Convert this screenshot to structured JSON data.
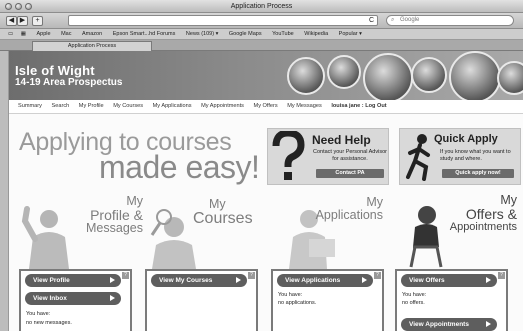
{
  "browser": {
    "window_title": "Application Process",
    "url": "",
    "search_placeholder": "Google",
    "bookmarks": [
      "Apple",
      "Mac",
      "Amazon",
      "Epson Smart...hd Forums",
      "News (109) ▾",
      "Google Maps",
      "YouTube",
      "Wikipedia",
      "Popular ▾"
    ],
    "tab_label": "Application Process"
  },
  "site": {
    "title": "Isle of Wight",
    "subtitle": "14-19 Area Prospectus",
    "nav": [
      "Summary",
      "Search",
      "My Profile",
      "My Courses",
      "My Applications",
      "My Appointments",
      "My Offers",
      "My Messages"
    ],
    "user_link": "louisa jane : Log Out"
  },
  "hero": {
    "line1": "Applying to courses",
    "line2": "made easy!"
  },
  "need_help": {
    "title": "Need Help",
    "text": "Contact your Personal Advisor for assistance.",
    "button": "Contact PA"
  },
  "quick_apply": {
    "title": "Quick Apply",
    "text": "If you know what you want to study and where.",
    "button": "Quick apply now!"
  },
  "sections": {
    "profile": {
      "title_line1": "My",
      "title_line2": "Profile &",
      "title_line3": "Messages",
      "button1": "View Profile",
      "button2": "View Inbox",
      "text1": "You have:",
      "text2": "no new messages."
    },
    "courses": {
      "title_line1": "My",
      "title_line2": "Courses",
      "button1": "View My Courses"
    },
    "applications": {
      "title_line1": "My",
      "title_line2": "Applications",
      "button1": "View Applications",
      "text1": "You have:",
      "text2": "no applications."
    },
    "offers": {
      "title_line1": "My",
      "title_line2": "Offers &",
      "title_line3": "Appointments",
      "button1": "View Offers",
      "button2": "View Appointments",
      "text1": "You have:",
      "text2": "no offers."
    }
  },
  "help_badge": "?",
  "colors": {
    "header_dark": "#6d6d6d",
    "button": "#5e5e5e",
    "panel_border": "#7a7a7a"
  }
}
